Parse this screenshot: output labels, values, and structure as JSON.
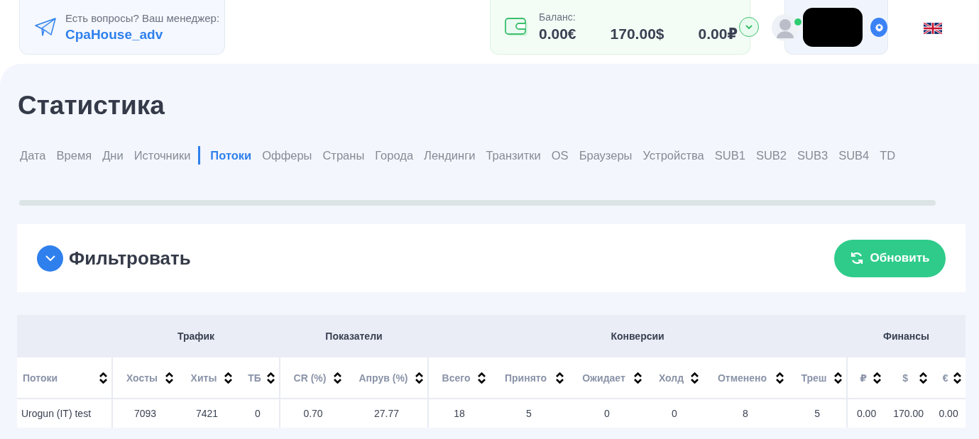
{
  "manager": {
    "prompt": "Есть вопросы? Ваш менеджер:",
    "name": "CpaHouse_adv"
  },
  "balance": {
    "label": "Баланс:",
    "amounts": [
      "0.00€",
      "170.00$",
      "0.00₽"
    ]
  },
  "user": {
    "online": true
  },
  "title": "Статистика",
  "tabs": [
    {
      "label": "Дата",
      "selected": false
    },
    {
      "label": "Время",
      "selected": false
    },
    {
      "label": "Дни",
      "selected": false
    },
    {
      "label": "Источники",
      "selected": false
    },
    {
      "label": "Потоки",
      "selected": true
    },
    {
      "label": "Офферы",
      "selected": false
    },
    {
      "label": "Страны",
      "selected": false
    },
    {
      "label": "Города",
      "selected": false
    },
    {
      "label": "Лендинги",
      "selected": false
    },
    {
      "label": "Транзитки",
      "selected": false
    },
    {
      "label": "OS",
      "selected": false
    },
    {
      "label": "Браузеры",
      "selected": false
    },
    {
      "label": "Устройства",
      "selected": false
    },
    {
      "label": "SUB1",
      "selected": false
    },
    {
      "label": "SUB2",
      "selected": false
    },
    {
      "label": "SUB3",
      "selected": false
    },
    {
      "label": "SUB4",
      "selected": false
    },
    {
      "label": "TD",
      "selected": false
    }
  ],
  "filter": {
    "title": "Фильтровать",
    "expanded": false,
    "refresh_button": "Обновить"
  },
  "table": {
    "groups": [
      {
        "label": "Трафик"
      },
      {
        "label": "Показатели"
      },
      {
        "label": "Конверсии"
      },
      {
        "label": "Финансы"
      }
    ],
    "columns": [
      "Потоки",
      "Хосты",
      "Хиты",
      "ТБ",
      "CR (%)",
      "Апрув (%)",
      "Всего",
      "Принято",
      "Ожидает",
      "Холд",
      "Отменено",
      "Треш",
      "₽",
      "$",
      "€"
    ],
    "rows": [
      [
        "Urogun (IT) test",
        "7093",
        "7421",
        "0",
        "0.70",
        "27.77",
        "18",
        "5",
        "0",
        "0",
        "8",
        "5",
        "0.00",
        "170.00",
        "0.00"
      ]
    ]
  }
}
